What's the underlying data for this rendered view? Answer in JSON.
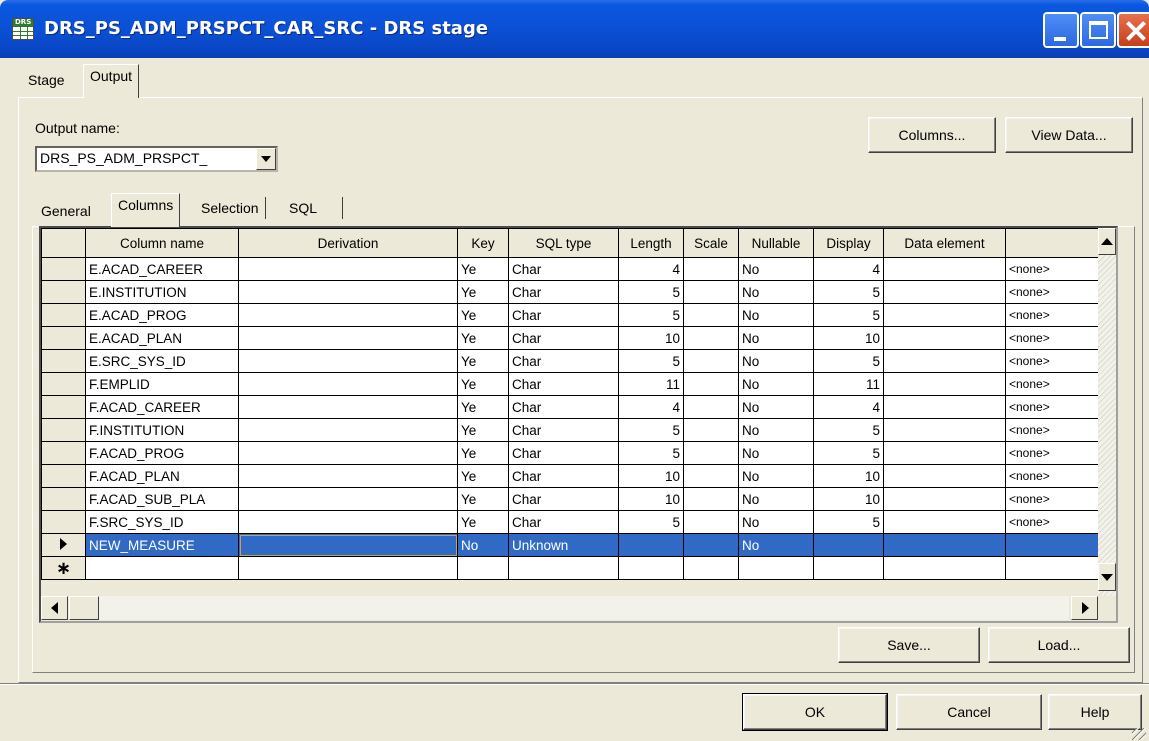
{
  "window": {
    "title": "DRS_PS_ADM_PRSPCT_CAR_SRC - DRS stage",
    "icon_label": "DRS"
  },
  "outer_tabs": [
    {
      "label": "Stage",
      "active": false
    },
    {
      "label": "Output",
      "active": true
    }
  ],
  "output": {
    "name_label": "Output name:",
    "name_value": "DRS_PS_ADM_PRSPCT_",
    "columns_button": "Columns...",
    "view_data_button": "View Data..."
  },
  "inner_tabs": [
    {
      "label": "General",
      "active": false
    },
    {
      "label": "Columns",
      "active": true
    },
    {
      "label": "Selection",
      "active": false
    },
    {
      "label": "SQL",
      "active": false
    }
  ],
  "grid": {
    "headers": [
      "Column name",
      "Derivation",
      "Key",
      "SQL type",
      "Length",
      "Scale",
      "Nullable",
      "Display",
      "Data element",
      ""
    ],
    "rows": [
      {
        "name": "E.ACAD_CAREER",
        "derivation": "",
        "key": "Ye",
        "sql_type": "Char",
        "length": "4",
        "scale": "",
        "nullable": "No",
        "display": "4",
        "data_element": "",
        "extra": "<none>"
      },
      {
        "name": "E.INSTITUTION",
        "derivation": "",
        "key": "Ye",
        "sql_type": "Char",
        "length": "5",
        "scale": "",
        "nullable": "No",
        "display": "5",
        "data_element": "",
        "extra": "<none>"
      },
      {
        "name": "E.ACAD_PROG",
        "derivation": "",
        "key": "Ye",
        "sql_type": "Char",
        "length": "5",
        "scale": "",
        "nullable": "No",
        "display": "5",
        "data_element": "",
        "extra": "<none>"
      },
      {
        "name": "E.ACAD_PLAN",
        "derivation": "",
        "key": "Ye",
        "sql_type": "Char",
        "length": "10",
        "scale": "",
        "nullable": "No",
        "display": "10",
        "data_element": "",
        "extra": "<none>"
      },
      {
        "name": "E.SRC_SYS_ID",
        "derivation": "",
        "key": "Ye",
        "sql_type": "Char",
        "length": "5",
        "scale": "",
        "nullable": "No",
        "display": "5",
        "data_element": "",
        "extra": "<none>"
      },
      {
        "name": "F.EMPLID",
        "derivation": "",
        "key": "Ye",
        "sql_type": "Char",
        "length": "11",
        "scale": "",
        "nullable": "No",
        "display": "11",
        "data_element": "",
        "extra": "<none>"
      },
      {
        "name": "F.ACAD_CAREER",
        "derivation": "",
        "key": "Ye",
        "sql_type": "Char",
        "length": "4",
        "scale": "",
        "nullable": "No",
        "display": "4",
        "data_element": "",
        "extra": "<none>"
      },
      {
        "name": "F.INSTITUTION",
        "derivation": "",
        "key": "Ye",
        "sql_type": "Char",
        "length": "5",
        "scale": "",
        "nullable": "No",
        "display": "5",
        "data_element": "",
        "extra": "<none>"
      },
      {
        "name": "F.ACAD_PROG",
        "derivation": "",
        "key": "Ye",
        "sql_type": "Char",
        "length": "5",
        "scale": "",
        "nullable": "No",
        "display": "5",
        "data_element": "",
        "extra": "<none>"
      },
      {
        "name": "F.ACAD_PLAN",
        "derivation": "",
        "key": "Ye",
        "sql_type": "Char",
        "length": "10",
        "scale": "",
        "nullable": "No",
        "display": "10",
        "data_element": "",
        "extra": "<none>"
      },
      {
        "name": "F.ACAD_SUB_PLA",
        "derivation": "",
        "key": "Ye",
        "sql_type": "Char",
        "length": "10",
        "scale": "",
        "nullable": "No",
        "display": "10",
        "data_element": "",
        "extra": "<none>"
      },
      {
        "name": "F.SRC_SYS_ID",
        "derivation": "",
        "key": "Ye",
        "sql_type": "Char",
        "length": "5",
        "scale": "",
        "nullable": "No",
        "display": "5",
        "data_element": "",
        "extra": "<none>"
      },
      {
        "name": "NEW_MEASURE",
        "derivation": "",
        "key": "No",
        "sql_type": "Unknown",
        "length": "",
        "scale": "",
        "nullable": "No",
        "display": "",
        "data_element": "",
        "extra": "",
        "selected": true,
        "marker": "current-row-arrow"
      },
      {
        "name": "",
        "derivation": "",
        "key": "",
        "sql_type": "",
        "length": "",
        "scale": "",
        "nullable": "",
        "display": "",
        "data_element": "",
        "extra": "",
        "marker": "new-row-asterisk"
      }
    ]
  },
  "buttons": {
    "save": "Save...",
    "load": "Load...",
    "ok": "OK",
    "cancel": "Cancel",
    "help": "Help"
  },
  "colors": {
    "titlebar": "#0b50d6",
    "selection": "#316ac5",
    "face": "#ece9d8",
    "close_button": "#c5401c"
  }
}
